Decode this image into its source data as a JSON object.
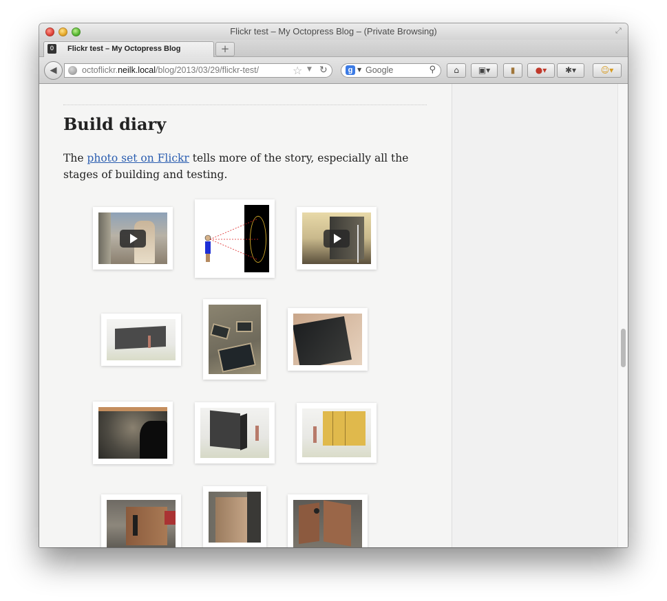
{
  "window": {
    "title": "Flickr test – My Octopress Blog – (Private Browsing)"
  },
  "tabs": [
    {
      "label": "Flickr test – My Octopress Blog",
      "favicon": "O"
    }
  ],
  "newtab_label": "+",
  "navbar": {
    "url_prefix": "octoflickr.",
    "url_host": "neilk.local",
    "url_path": "/blog/2013/03/29/flickr-test/",
    "search_placeholder": "Google",
    "search_engine_letter": "g"
  },
  "article": {
    "heading": "Build diary",
    "para_before": "The ",
    "link_text": "photo set on Flickr",
    "para_after": " tells more of the story, especially all the stages of building and testing."
  },
  "icons": {
    "back": "back-arrow-icon",
    "globe": "globe-icon",
    "star": "bookmark-star-icon",
    "reload": "reload-icon",
    "search": "magnifier-icon",
    "home": "home-icon",
    "bookmarks": "bookmarks-icon",
    "notebook": "notebook-icon",
    "addon1": "addon-icon",
    "addon2": "addon-icon",
    "persona": "persona-icon"
  },
  "colors": {
    "link": "#2a5db0",
    "text": "#222222",
    "page_bg": "#f5f5f4"
  },
  "photos": [
    {
      "name": "video-thumbnail-desert-person",
      "video": true
    },
    {
      "name": "diagram-person-viewing-mirror",
      "video": false
    },
    {
      "name": "video-thumbnail-sunset-panel",
      "video": true
    },
    {
      "name": "sketch-long-panel-wall",
      "video": false
    },
    {
      "name": "photo-mirror-panels-on-ground",
      "video": false
    },
    {
      "name": "photo-dark-mirror-panel",
      "video": false
    },
    {
      "name": "photo-mirror-closeup-reflection",
      "video": false
    },
    {
      "name": "sketch-dark-cube-with-person",
      "video": false
    },
    {
      "name": "sketch-yellow-panels-with-person",
      "video": false
    },
    {
      "name": "photo-wooden-box-in-warehouse",
      "video": false
    },
    {
      "name": "photo-wooden-box-side",
      "video": false
    },
    {
      "name": "photo-wooden-panels-frame",
      "video": false
    }
  ]
}
